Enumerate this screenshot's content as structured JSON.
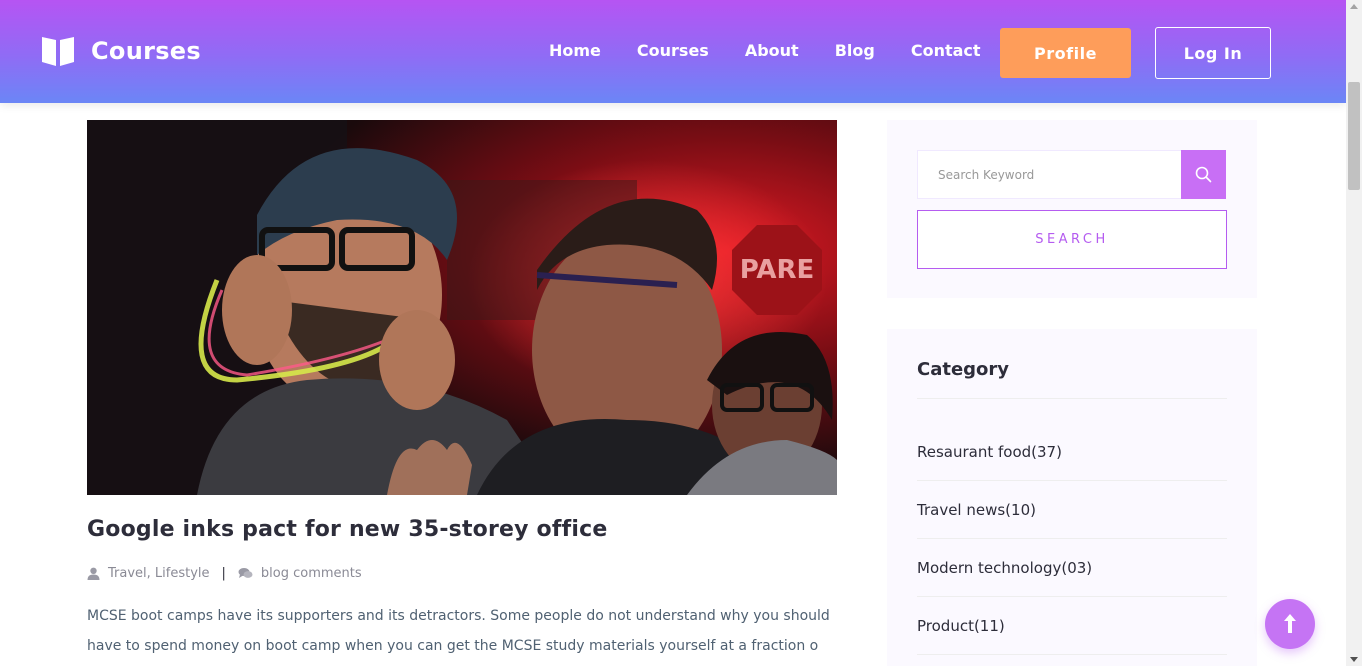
{
  "header": {
    "brand": "Courses",
    "nav": [
      {
        "label": "Home"
      },
      {
        "label": "Courses"
      },
      {
        "label": "About"
      },
      {
        "label": "Blog"
      },
      {
        "label": "Contact"
      }
    ],
    "profile_label": "Profile",
    "login_label": "Log In",
    "colors": {
      "gradient_top": "#b654f3",
      "gradient_bottom": "#6b86f6",
      "profile_bg": "#fe9d5a"
    }
  },
  "post": {
    "title": "Google inks pact for new 35-storey office",
    "categories": "Travel, Lifestyle",
    "separator": "|",
    "comments": "blog comments",
    "excerpt": "MCSE boot camps have its supporters and its detractors. Some people do not understand why you should have to spend money on boot camp when you can get the MCSE study materials yourself at a fraction o",
    "icons": {
      "author": "user-icon",
      "comments": "comments-icon"
    }
  },
  "sidebar": {
    "search": {
      "placeholder": "Search Keyword",
      "button_label": "SEARCH",
      "accent": "#c86ff5"
    },
    "category": {
      "title": "Category",
      "items": [
        {
          "label": "Resaurant food(37)"
        },
        {
          "label": "Travel news(10)"
        },
        {
          "label": "Modern technology(03)"
        },
        {
          "label": "Product(11)"
        }
      ]
    }
  }
}
